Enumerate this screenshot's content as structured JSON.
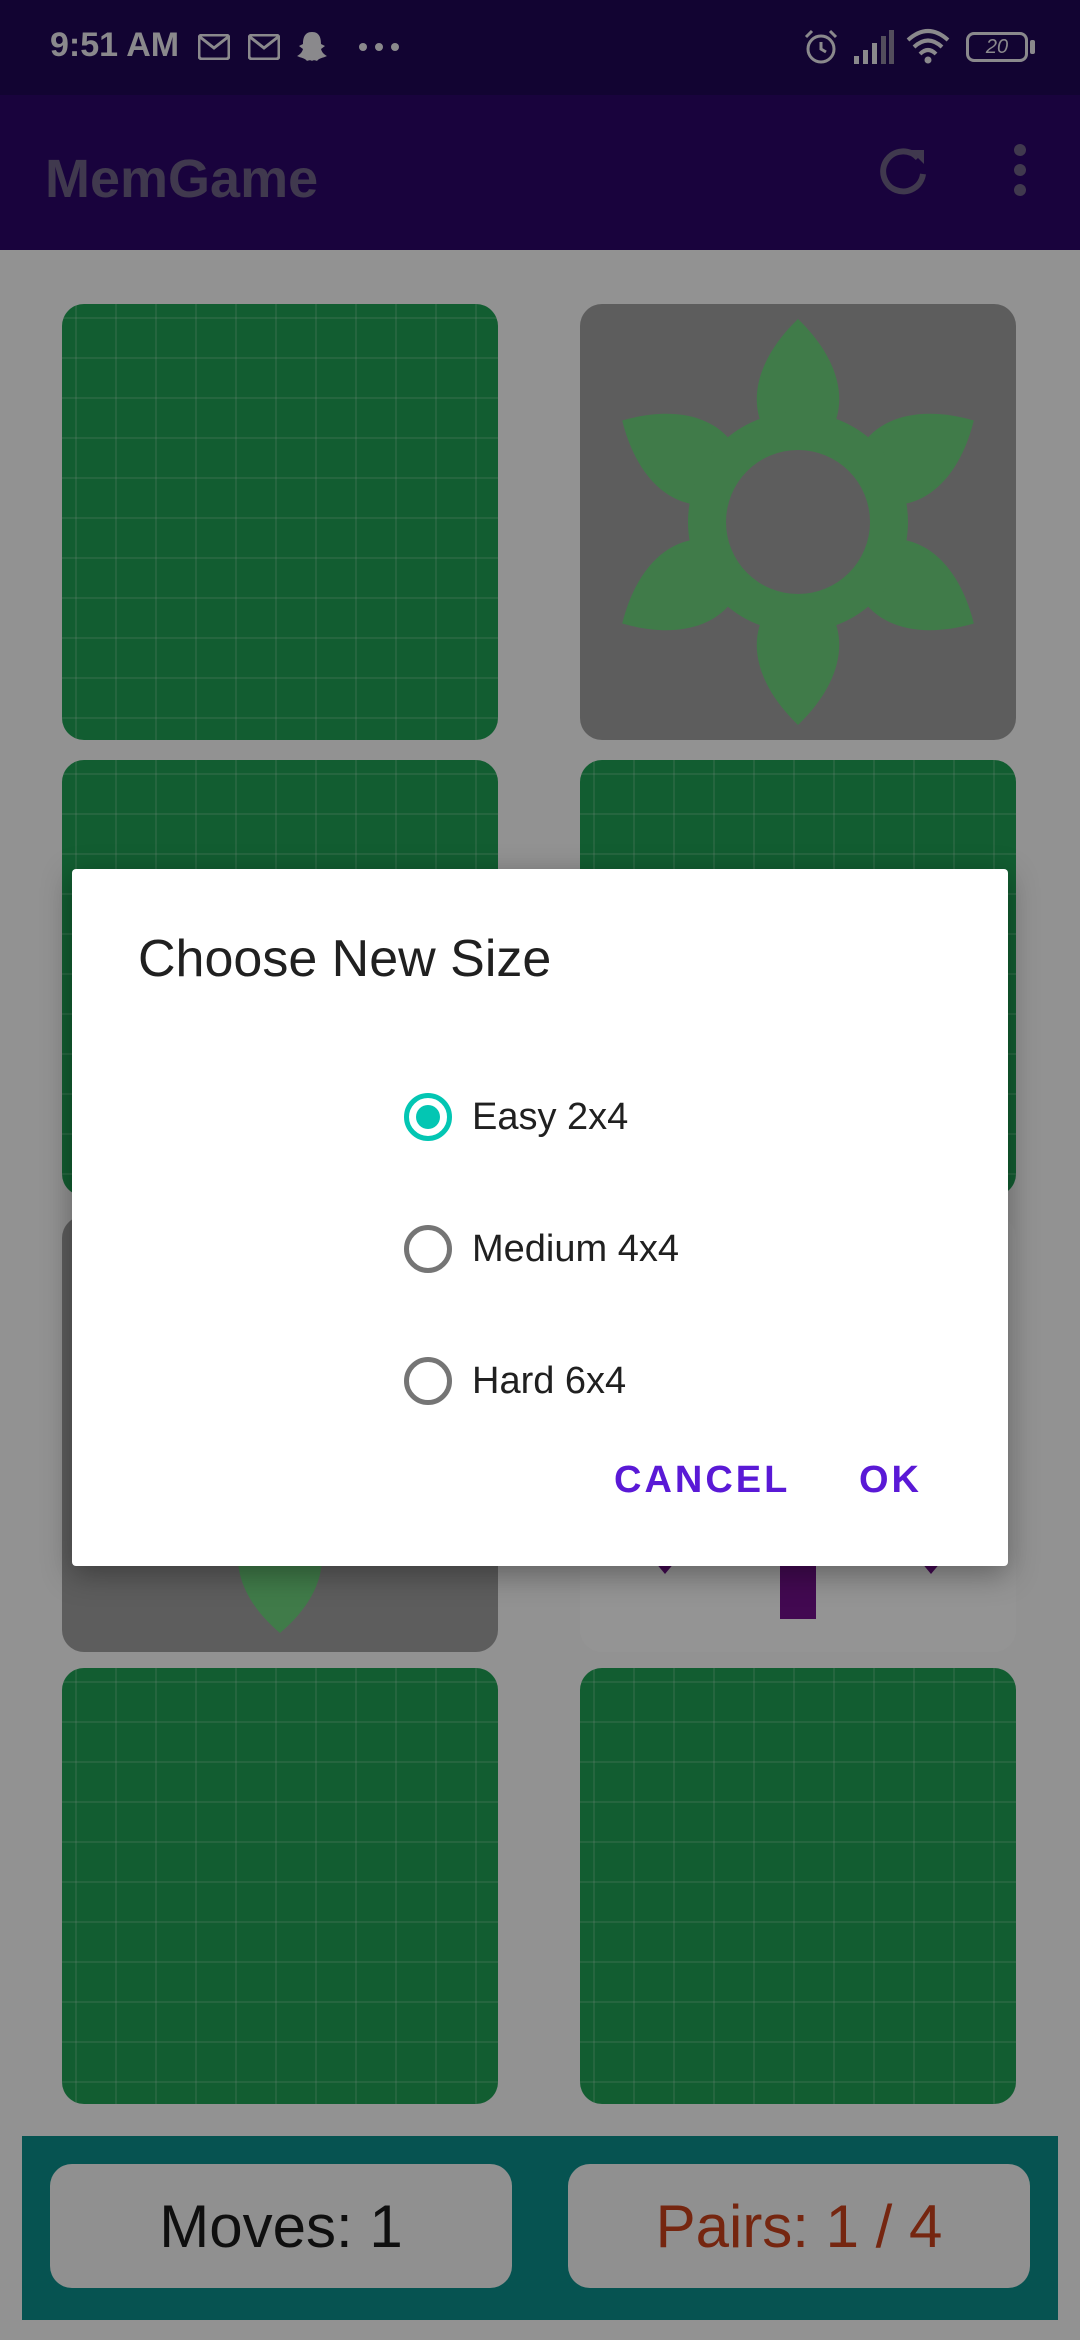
{
  "status_bar": {
    "time": "9:51 AM",
    "battery": "20",
    "icons": [
      "gmail-icon",
      "gmail-icon",
      "snapchat-icon",
      "more-dots-icon",
      "alarm-icon",
      "signal-icon",
      "wifi-icon",
      "battery-icon"
    ]
  },
  "app_bar": {
    "title": "MemGame",
    "refresh_icon": "refresh-icon",
    "menu_icon": "overflow-menu-icon"
  },
  "board": {
    "cards": [
      {
        "state": "face-down"
      },
      {
        "state": "face-up",
        "image": "flower"
      },
      {
        "state": "face-down"
      },
      {
        "state": "face-down"
      },
      {
        "state": "face-up",
        "image": "flower"
      },
      {
        "state": "face-up",
        "image": "purple-shape"
      },
      {
        "state": "face-down"
      },
      {
        "state": "face-down"
      }
    ]
  },
  "bottom_bar": {
    "moves_text": "Moves: 1",
    "pairs_text": "Pairs: 1 / 4"
  },
  "dialog": {
    "title": "Choose New Size",
    "options": [
      {
        "label": "Easy 2x4",
        "selected": true
      },
      {
        "label": "Medium 4x4",
        "selected": false
      },
      {
        "label": "Hard 6x4",
        "selected": false
      }
    ],
    "cancel_label": "CANCEL",
    "ok_label": "OK"
  },
  "colors": {
    "status_bar": "#1e0754",
    "app_bar": "#2b0566",
    "card_back": "#1e9c52",
    "accent_radio": "#03c6b3",
    "dialog_button": "#5a19d6",
    "bottom_bar": "#0a8a87",
    "pairs_text": "#c4401c"
  }
}
